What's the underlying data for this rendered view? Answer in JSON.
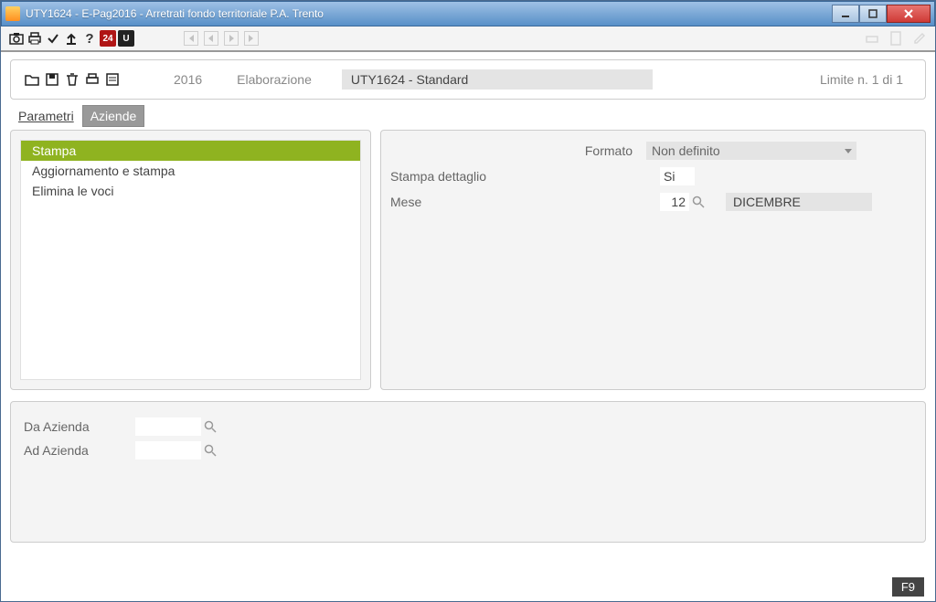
{
  "window": {
    "title": "UTY1624  -  E-Pag2016  -  Arretrati fondo territoriale P.A. Trento"
  },
  "toolbar": {
    "badge24": "24",
    "badgeU": "U"
  },
  "header": {
    "year": "2016",
    "elaborazione_label": "Elaborazione",
    "dropdown_value": "UTY1624 - Standard",
    "limit_text": "Limite n. 1 di 1"
  },
  "tabs": {
    "parametri": "Parametri",
    "aziende": "Aziende"
  },
  "actions": {
    "items": [
      {
        "label": "Stampa",
        "selected": true
      },
      {
        "label": "Aggiornamento e stampa",
        "selected": false
      },
      {
        "label": "Elimina le voci",
        "selected": false
      }
    ]
  },
  "form": {
    "formato_label": "Formato",
    "formato_value": "Non definito",
    "stampa_dettaglio_label": "Stampa dettaglio",
    "stampa_dettaglio_value": "Si",
    "mese_label": "Mese",
    "mese_num": "12",
    "mese_name": "DICEMBRE"
  },
  "bottom": {
    "da_azienda_label": "Da Azienda",
    "ad_azienda_label": "Ad Azienda",
    "da_azienda_value": "",
    "ad_azienda_value": ""
  },
  "status": {
    "key": "F9"
  }
}
